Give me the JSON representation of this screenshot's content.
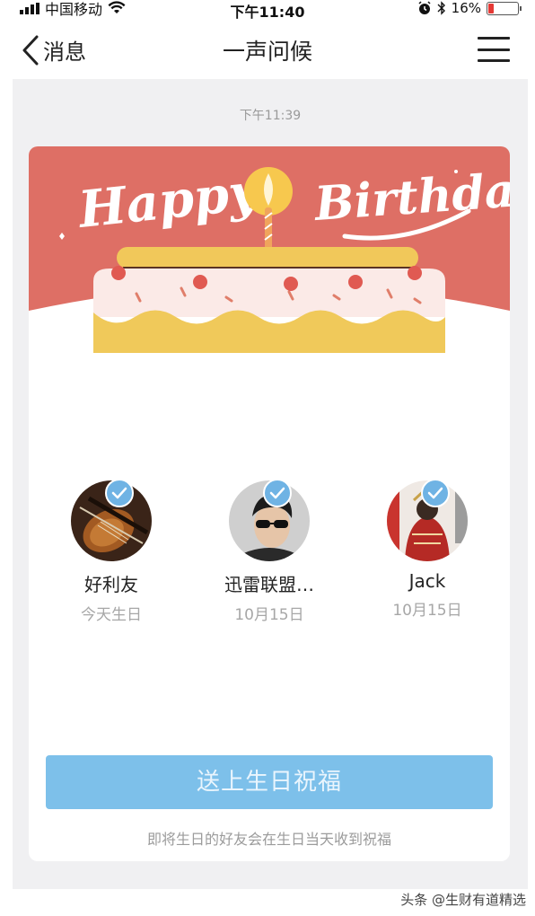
{
  "status_bar": {
    "carrier": "中国移动",
    "time": "下午11:40",
    "battery": "16%",
    "battery_level": 0.16
  },
  "navbar": {
    "back_label": "消息",
    "title": "一声问候"
  },
  "chat": {
    "timestamp": "下午11:39"
  },
  "card": {
    "friends": [
      {
        "name": "好利友",
        "date": "今天生日",
        "selected": true
      },
      {
        "name": "迅雷联盟…",
        "date": "10月15日",
        "selected": true
      },
      {
        "name": "Jack",
        "date": "10月15日",
        "selected": true
      }
    ],
    "send_button_label": "送上生日祝福",
    "hint": "即将生日的好友会在生日当天收到祝福"
  },
  "watermark": "头条 @生财有道精选",
  "colors": {
    "banner_red": "#de6f65",
    "button_blue": "#7dc0ea",
    "check_blue": "#6fb3e4",
    "chat_bg": "#f0f0f2"
  }
}
